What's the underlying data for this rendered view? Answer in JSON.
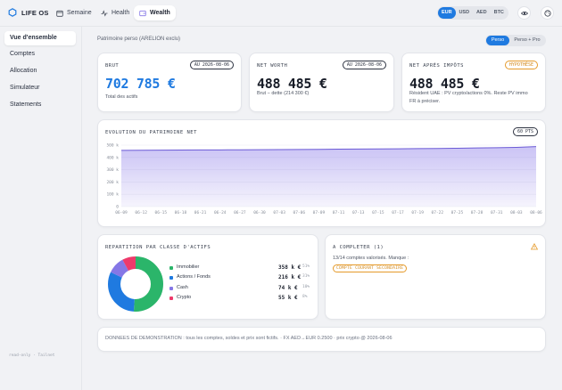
{
  "app": {
    "title": "LIFE OS"
  },
  "nav": {
    "tabs": [
      {
        "label": "Semaine",
        "icon": "calendar-icon"
      },
      {
        "label": "Health",
        "icon": "activity-icon"
      },
      {
        "label": "Wealth",
        "icon": "wallet-icon"
      }
    ],
    "active": "Wealth"
  },
  "currency": {
    "options": [
      "EUR",
      "USD",
      "AED",
      "BTC"
    ],
    "selected": "EUR"
  },
  "sidebar": {
    "items": [
      {
        "label": "Vue d'ensemble"
      },
      {
        "label": "Comptes"
      },
      {
        "label": "Allocation"
      },
      {
        "label": "Simulateur"
      },
      {
        "label": "Statements"
      }
    ],
    "footer": "read-only · Tailnet"
  },
  "page": {
    "subtitle": "Patrimoine perso (ARELION exclu)",
    "toggle": {
      "on": "Perso",
      "off": "Perso + Pro"
    }
  },
  "cards": {
    "brut": {
      "label": "BRUT",
      "date": "AU 2026-08-06",
      "value": "702 785 €",
      "sub": "Total des actifs"
    },
    "networth": {
      "label": "NET WORTH",
      "date": "AU 2026-08-06",
      "value": "488 485 €",
      "sub": "Brut − dette (214 300 €)"
    },
    "netimpots": {
      "label": "NET APRÈS IMPÔTS",
      "badge": "HYPOTHÈSE",
      "value": "488 485 €",
      "sub1": "Résident UAE : PV crypto/actions 0%. Reste PV immo",
      "sub2": "FR à préciser."
    }
  },
  "evolution": {
    "label": "EVOLUTION DU PATRIMOINE NET",
    "badge": "60 PTS"
  },
  "chart_data": {
    "type": "area",
    "x": [
      "06-09",
      "06-12",
      "06-15",
      "06-18",
      "06-21",
      "06-24",
      "06-27",
      "06-30",
      "07-03",
      "07-06",
      "07-09",
      "07-11",
      "07-13",
      "07-15",
      "07-17",
      "07-19",
      "07-22",
      "07-25",
      "07-28",
      "07-31",
      "08-03",
      "08-06"
    ],
    "ytick_labels": [
      "500 k",
      "400 k",
      "300 k",
      "200 k",
      "100 k",
      "0"
    ],
    "ylim": [
      0,
      500000
    ],
    "values": [
      457000,
      458000,
      459000,
      460000,
      461000,
      461500,
      462000,
      463000,
      464000,
      465000,
      466000,
      467000,
      468000,
      469000,
      470000,
      471500,
      473000,
      475000,
      477000,
      479000,
      482000,
      488485
    ],
    "grid": true
  },
  "allocation": {
    "label": "REPARTITION PAR CLASSE D'ACTIFS",
    "rows": [
      {
        "name": "Immobilier",
        "amount": "358 k €",
        "pct": "51%",
        "value": 51,
        "color": "#2bb56a"
      },
      {
        "name": "Actions / Fonds",
        "amount": "216 k €",
        "pct": "31%",
        "value": 31,
        "color": "#1f7ae0"
      },
      {
        "name": "Cash",
        "amount": "74 k €",
        "pct": "10%",
        "value": 10,
        "color": "#8577e6"
      },
      {
        "name": "Crypto",
        "amount": "55 k €",
        "pct": "8%",
        "value": 8,
        "color": "#ee3a6b"
      }
    ]
  },
  "todo": {
    "label": "A COMPLETER (1)",
    "sub": "13/14 comptes valorisés. Manque :",
    "badge": "COMPTE COURANT SECONDAIRE"
  },
  "footer": {
    "note": "DONNEES DE DEMONSTRATION : tous les comptes, soldes et prix sont fictifs. · FX AED→EUR 0.2500 · prix crypto @ 2026-08-06"
  },
  "colors": {
    "accent": "#1f7ae0",
    "warning": "#e59a2a",
    "area_fill": "#8a7ae8"
  }
}
